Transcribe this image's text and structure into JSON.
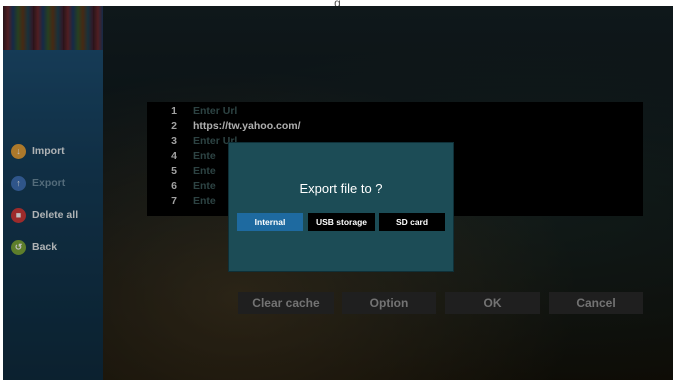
{
  "caption": "g",
  "sidebar": {
    "items": [
      {
        "label": "Import",
        "icon": "download-icon",
        "color": "#e7a23a",
        "enabled": true
      },
      {
        "label": "Export",
        "icon": "upload-icon",
        "color": "#3f72b8",
        "enabled": false
      },
      {
        "label": "Delete all",
        "icon": "trash-icon",
        "color": "#d23a3a",
        "enabled": true
      },
      {
        "label": "Back",
        "icon": "back-icon",
        "color": "#7ea83a",
        "enabled": true
      }
    ]
  },
  "url_list": {
    "rows": [
      {
        "num": "1",
        "text": "Enter Url",
        "filled": false
      },
      {
        "num": "2",
        "text": "https://tw.yahoo.com/",
        "filled": true
      },
      {
        "num": "3",
        "text": "Enter Url",
        "filled": false
      },
      {
        "num": "4",
        "text": "Ente",
        "filled": false
      },
      {
        "num": "5",
        "text": "Ente",
        "filled": false
      },
      {
        "num": "6",
        "text": "Ente",
        "filled": false
      },
      {
        "num": "7",
        "text": "Ente",
        "filled": false
      }
    ]
  },
  "actions": {
    "clear_cache": "Clear cache",
    "option": "Option",
    "ok": "OK",
    "cancel": "Cancel"
  },
  "dialog": {
    "title": "Export file to ?",
    "options": [
      "Internal",
      "USB storage",
      "SD card"
    ],
    "selected": "Internal"
  },
  "colors": {
    "dialog_bg": "#1c4c56",
    "selected_button": "#1e6aa0",
    "sidebar_bg": "#1d4f73"
  }
}
